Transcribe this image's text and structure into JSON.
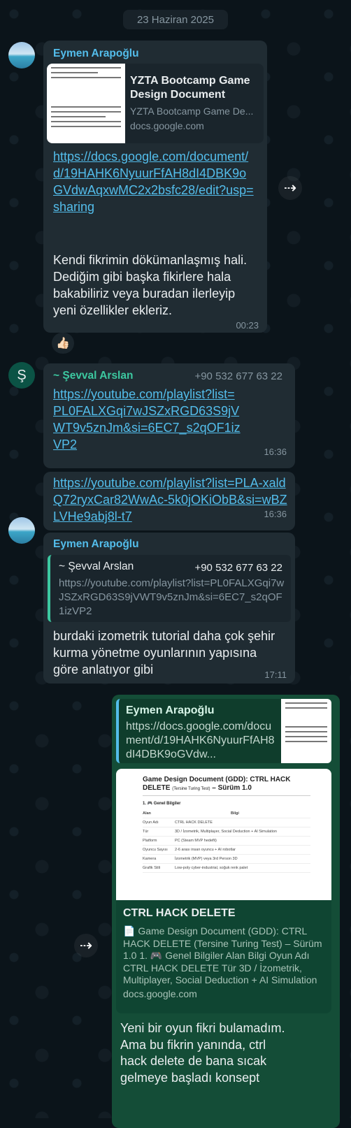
{
  "date_chip": "23 Haziran 2025",
  "colors": {
    "background": "#0b141a",
    "incoming_bubble": "#202c33",
    "outgoing_bubble": "#144d37",
    "link": "#53bdeb",
    "sender_blue": "#53bdeb",
    "sender_green": "#3cc8a0"
  },
  "messages": [
    {
      "sender": "Eymen Arapoğlu",
      "preview_title": "YZTA Bootcamp Game Design Document",
      "preview_desc": "YZTA Bootcamp Game De...",
      "preview_domain": "docs.google.com",
      "link": "https://docs.google.com/document/d/19HAHK6NyuurFfAH8dI4DBK9oGVdwAqxwMC2x2bsfc28/edit?usp=sharing",
      "text": "Kendi fikrimin dökümanlaşmış hali. Dediğim gibi başka fikirlere hala bakabiliriz veya buradan ilerleyip yeni özellikler ekleriz.",
      "time": "00:23",
      "reaction": "👍🏻"
    },
    {
      "sender": "~ Şevval Arslan",
      "avatar_letter": "Ş",
      "phone": "+90 532 677 63 22",
      "link": "https://youtube.com/playlist?list=PL0FALXGqi7wJSZxRGD63S9jVWT9v5znJm&si=6EC7_s2qOF1izVP2",
      "time": "16:36"
    },
    {
      "link": "https://youtube.com/playlist?list=PLA-xaldQ72ryxCar82WwAc-5k0jOKiObB&si=wBZLVHe9abj8l-t7",
      "time": "16:36"
    },
    {
      "sender": "Eymen Arapoğlu",
      "quote_sender": "~ Şevval Arslan",
      "quote_phone": "+90 532 677 63 22",
      "quote_text": "https://youtube.com/playlist?list=PL0FALXGqi7wJSZxRGD63S9jVWT9v5znJm&si=6EC7_s2qOF1izVP2",
      "text": "burdaki izometrik tutorial daha çok şehir kurma yönetme oyunlarının yapısına göre anlatıyor gibi",
      "time": "17:11"
    },
    {
      "quote_sender": "Eymen Arapoğlu",
      "quote_text": "https://docs.google.com/document/d/19HAHK6NyuurFfAH8dI4DBK9oGVdw...",
      "doc_heading": "Game Design Document (GDD): CTRL HACK DELETE",
      "doc_heading_small": "(Tersine Turing Test)",
      "doc_heading_tail": "– Sürüm 1.0",
      "doc_section": "1. 🎮 Genel Bilgiler",
      "doc_table_head": [
        "Alan",
        "Bilgi"
      ],
      "doc_table": [
        [
          "Oyun Adı",
          "CTRL HACK DELETE"
        ],
        [
          "Tür",
          "3D / İzometrik, Multiplayer, Social Deduction + AI Simulation"
        ],
        [
          "Platform",
          "PC (Steam MVP hedefli)"
        ],
        [
          "Oyuncu Sayısı",
          "2-6 arası insan oyuncu + AI robotlar"
        ],
        [
          "Kamera",
          "İzometrik (MVP) veya 3rd Person 3D"
        ],
        [
          "Grafik Stili",
          "Low-poly cyber-industrial, soğuk renk palet"
        ]
      ],
      "preview_title": "CTRL HACK DELETE",
      "preview_desc": "📄 Game Design Document (GDD): CTRL HACK DELETE (Tersine Turing Test) – Sürüm 1.0 1. 🎮 Genel Bilgiler Alan Bilgi Oyun Adı CTRL HACK DELETE Tür 3D / İzometrik, Multiplayer, Social Deduction + AI Simulation Platform PC (Steam MVP hede...",
      "preview_domain": "docs.google.com",
      "text": "Yeni bir oyun fikri bulamadım. Ama bu fikrin yanında, ctrl hack delete de bana sıcak gelmeye başladı konsept"
    }
  ],
  "icons": {
    "forward": "forward-share-icon"
  }
}
